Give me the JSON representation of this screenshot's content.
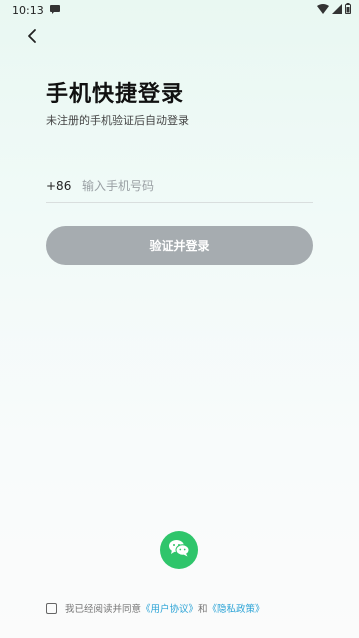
{
  "status_bar": {
    "time": "10:13"
  },
  "header": {
    "title": "手机快捷登录",
    "subtitle": "未注册的手机验证后自动登录"
  },
  "form": {
    "country_code": "+86",
    "phone_placeholder": "输入手机号码",
    "login_button": "验证并登录"
  },
  "agreement": {
    "prefix": "我已经阅读并同意",
    "user_agreement": "《用户协议》",
    "conjunction": "和",
    "privacy_policy": "《隐私政策》"
  },
  "colors": {
    "accent": "#2fc56b",
    "link": "#2aa3d6",
    "button_disabled": "#a6acb0"
  },
  "icons": [
    "back-arrow-icon",
    "wechat-icon",
    "wifi-icon",
    "signal-icon",
    "battery-icon",
    "notification-icon"
  ]
}
